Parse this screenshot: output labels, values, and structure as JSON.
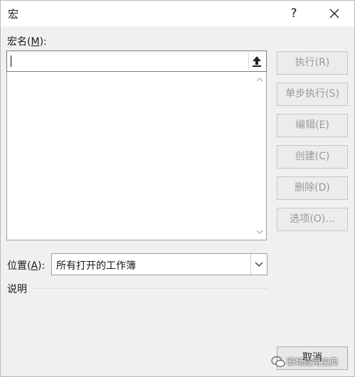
{
  "window": {
    "title": "宏",
    "help_label": "?",
    "close_icon": "close-icon"
  },
  "macro_name": {
    "label_prefix": "宏名(",
    "label_mnemonic": "M",
    "label_suffix": "):",
    "value": "",
    "placeholder": "",
    "upload_icon": "upload-arrow-icon"
  },
  "macro_list": {
    "items": []
  },
  "buttons": {
    "run": "执行(R)",
    "step_into": "单步执行(S)",
    "edit": "编辑(E)",
    "create": "创建(C)",
    "delete": "删除(D)",
    "options": "选项(O)...",
    "cancel": "取消"
  },
  "location": {
    "label_prefix": "位置(",
    "label_mnemonic": "A",
    "label_suffix": "):",
    "selected": "所有打开的工作簿"
  },
  "description": {
    "label": "说明"
  },
  "watermark": {
    "text": "职场应用宝典"
  }
}
